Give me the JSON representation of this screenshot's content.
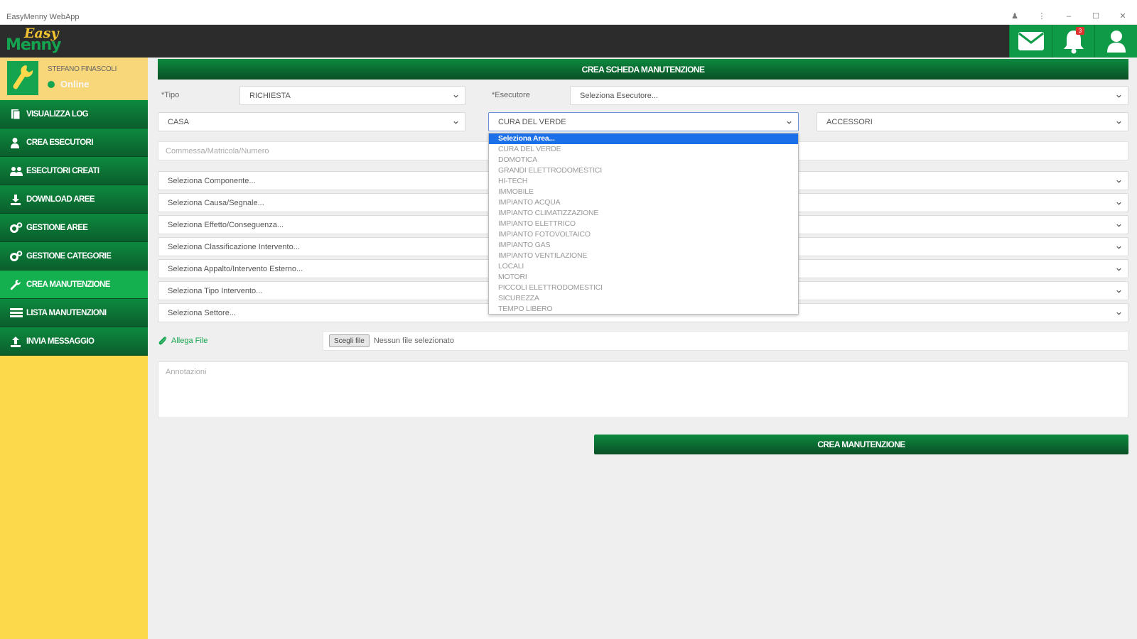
{
  "window": {
    "title": "EasyMenny WebApp",
    "controls": [
      "♟",
      "⋮",
      "–",
      "☐",
      "✕"
    ]
  },
  "header": {
    "logo_top": "Easy",
    "logo_bottom": "Menny",
    "notification_count": "3",
    "icons": [
      "mail-icon",
      "bell-icon",
      "user-icon"
    ],
    "accent": "#0e9a47"
  },
  "user": {
    "name": "STEFANO FINASCOLI",
    "status": "Online"
  },
  "sidebar": {
    "items": [
      {
        "label": "VISUALIZZA LOG",
        "icon": "log-icon"
      },
      {
        "label": "CREA ESECUTORI",
        "icon": "user-icon"
      },
      {
        "label": "ESECUTORI CREATI",
        "icon": "users-icon"
      },
      {
        "label": "DOWNLOAD AREE",
        "icon": "download-icon"
      },
      {
        "label": "GESTIONE AREE",
        "icon": "gears-icon"
      },
      {
        "label": "GESTIONE CATEGORIE",
        "icon": "gears-icon"
      },
      {
        "label": "CREA MANUTENZIONE",
        "icon": "wrench-icon",
        "active": true
      },
      {
        "label": "LISTA MANUTENZIONI",
        "icon": "list-icon"
      },
      {
        "label": "INVIA MESSAGGIO",
        "icon": "upload-icon"
      }
    ]
  },
  "form": {
    "title": "CREA SCHEDA MANUTENZIONE",
    "tipo_label": "*Tipo",
    "tipo_value": "RICHIESTA",
    "esecutore_label": "*Esecutore",
    "esecutore_value": "Seleziona Esecutore...",
    "casa_value": "CASA",
    "area_value": "CURA DEL VERDE",
    "accessori_value": "ACCESSORI",
    "commessa_placeholder": "Commessa/Matricola/Numero",
    "selects": [
      "Seleziona Componente...",
      "Seleziona Causa/Segnale...",
      "Seleziona Effetto/Conseguenza...",
      "Seleziona Classificazione Intervento...",
      "Seleziona Appalto/Intervento Esterno...",
      "Seleziona Tipo Intervento...",
      "Seleziona Settore..."
    ],
    "attach_label": "Allega File",
    "file_button": "Scegli file",
    "file_status": "Nessun file selezionato",
    "notes_placeholder": "Annotazioni",
    "submit_label": "CREA MANUTENZIONE"
  },
  "dropdown": {
    "options": [
      "Seleziona Area...",
      "CURA DEL VERDE",
      "DOMOTICA",
      "GRANDI ELETTRODOMESTICI",
      "HI-TECH",
      "IMMOBILE",
      "IMPIANTO ACQUA",
      "IMPIANTO CLIMATIZZAZIONE",
      "IMPIANTO ELETTRICO",
      "IMPIANTO FOTOVOLTAICO",
      "IMPIANTO GAS",
      "IMPIANTO VENTILAZIONE",
      "LOCALI",
      "MOTORI",
      "PICCOLI ELETTRODOMESTICI",
      "SICUREZZA",
      "TEMPO LIBERO"
    ],
    "highlighted": "Seleziona Area..."
  }
}
